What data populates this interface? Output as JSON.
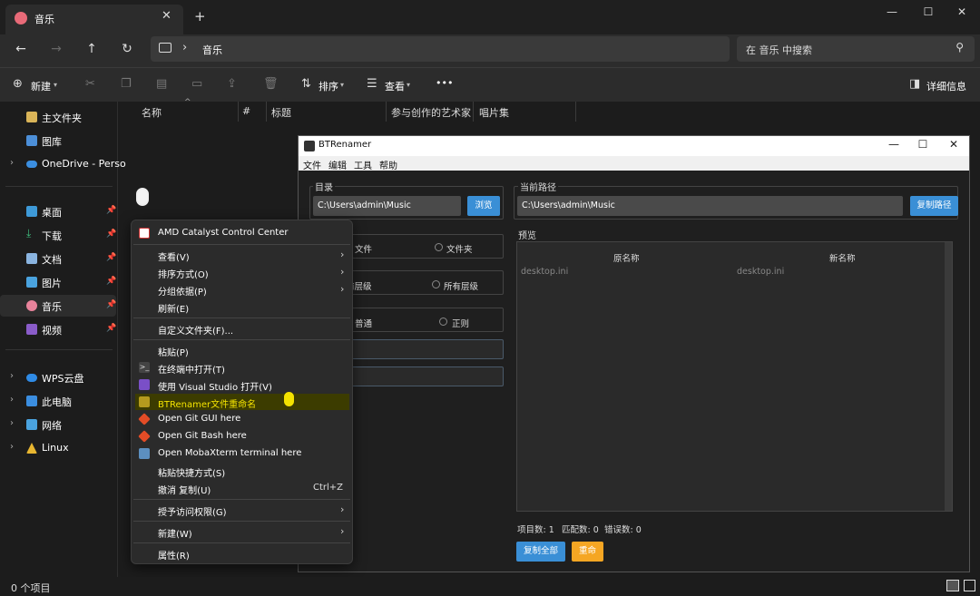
{
  "tab": {
    "title": "音乐",
    "close": "✕",
    "add": "+"
  },
  "window_controls": {
    "minimize": "—",
    "maximize": "☐",
    "close": "✕"
  },
  "nav": {
    "back": "←",
    "forward": "→",
    "up": "↑",
    "refresh": "↻",
    "breadcrumb_sep": "›",
    "location": "音乐"
  },
  "search": {
    "placeholder": "在 音乐 中搜索",
    "icon": "search-icon"
  },
  "toolbar": {
    "new_label": "新建",
    "sort_label": "排序",
    "view_label": "查看",
    "more": "•••",
    "details_label": "详细信息"
  },
  "sidebar": {
    "items": [
      {
        "label": "主文件夹",
        "icon": "home-icon"
      },
      {
        "label": "图库",
        "icon": "gallery-icon"
      },
      {
        "label": "OneDrive - Perso",
        "icon": "cloud-icon"
      },
      {
        "label": "桌面",
        "icon": "desktop-icon"
      },
      {
        "label": "下载",
        "icon": "download-icon"
      },
      {
        "label": "文档",
        "icon": "documents-icon"
      },
      {
        "label": "图片",
        "icon": "pictures-icon"
      },
      {
        "label": "音乐",
        "icon": "music-icon"
      },
      {
        "label": "视频",
        "icon": "videos-icon"
      },
      {
        "label": "WPS云盘",
        "icon": "wps-cloud-icon"
      },
      {
        "label": "此电脑",
        "icon": "this-pc-icon"
      },
      {
        "label": "网络",
        "icon": "network-icon"
      },
      {
        "label": "Linux",
        "icon": "linux-icon"
      }
    ]
  },
  "columns": [
    "名称",
    "#",
    "标题",
    "参与创作的艺术家",
    "唱片集"
  ],
  "status": {
    "items_count": "0 个项目"
  },
  "btrenamer": {
    "title": "BTRenamer",
    "menu": [
      "文件",
      "编辑",
      "工具",
      "帮助"
    ],
    "dir_label": "目录",
    "dir_value": "C:\\Users\\admin\\Music",
    "browse_button": "浏览",
    "current_path_label": "当前路径",
    "current_path_value": "C:\\Users\\admin\\Music",
    "copy_path_button": "复制路径",
    "radio_file": "文件",
    "radio_folder": "文件夹",
    "radio_level_current": "前层级",
    "radio_level_all": "所有层级",
    "radio_mode_normal": "普通",
    "radio_mode_regex": "正则",
    "preview_label": "预览",
    "preview_headers": [
      "原名称",
      "新名称"
    ],
    "preview_rows": [
      [
        "desktop.ini",
        "desktop.ini"
      ]
    ],
    "stats": {
      "items": "项目数: 1",
      "matches": "匹配数: 0",
      "errors": "错误数: 0"
    },
    "copy_all_button": "复制全部",
    "rename_button": "重命"
  },
  "context_menu": {
    "items": [
      {
        "label": "AMD Catalyst Control Center",
        "icon": "amd-icon"
      },
      {
        "label": "查看(V)",
        "submenu": true
      },
      {
        "label": "排序方式(O)",
        "submenu": true
      },
      {
        "label": "分组依据(P)",
        "submenu": true
      },
      {
        "label": "刷新(E)"
      },
      {
        "label": "自定义文件夹(F)..."
      },
      {
        "label": "粘贴(P)"
      },
      {
        "label": "在终端中打开(T)",
        "icon": "terminal-icon"
      },
      {
        "label": "使用 Visual Studio 打开(V)",
        "icon": "visual-studio-icon"
      },
      {
        "label": "BTRenamer文件重命名",
        "icon": "btrenamer-icon",
        "highlighted": true
      },
      {
        "label": "Open Git GUI here",
        "icon": "git-icon"
      },
      {
        "label": "Open Git Bash here",
        "icon": "git-icon"
      },
      {
        "label": "Open MobaXterm terminal here",
        "icon": "mobaxterm-icon"
      },
      {
        "label": "粘贴快捷方式(S)"
      },
      {
        "label": "撤消 复制(U)",
        "shortcut": "Ctrl+Z"
      },
      {
        "label": "授予访问权限(G)",
        "submenu": true
      },
      {
        "label": "新建(W)",
        "submenu": true
      },
      {
        "label": "属性(R)"
      }
    ]
  },
  "colors": {
    "accent_blue": "#3a8fd6",
    "accent_orange": "#f5a623",
    "highlight_yellow": "#f4e300"
  }
}
